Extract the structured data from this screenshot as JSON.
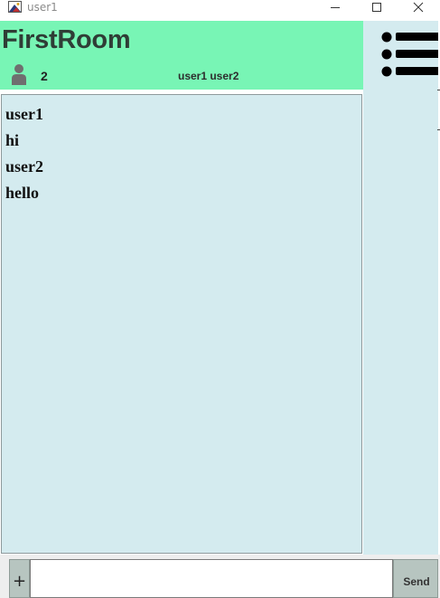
{
  "window": {
    "title": "user1",
    "icon": "app-logo-icon",
    "controls": [
      "minimize-icon",
      "maximize-icon",
      "close-icon"
    ]
  },
  "room": {
    "name": "FirstRoom",
    "member_icon": "person-icon",
    "member_count": "2",
    "members": "user1 user2"
  },
  "menu": {
    "icon": "list-menu-icon"
  },
  "messages": [
    {
      "text": "user1"
    },
    {
      "text": "hi"
    },
    {
      "text": "user2"
    },
    {
      "text": "hello"
    }
  ],
  "composer": {
    "attach_label": "+",
    "input_value": "",
    "send_label": "Send"
  },
  "colors": {
    "header_bg": "#78f5b5",
    "panel_bg": "#d4ebef",
    "button_bg": "#b7c5c0"
  }
}
